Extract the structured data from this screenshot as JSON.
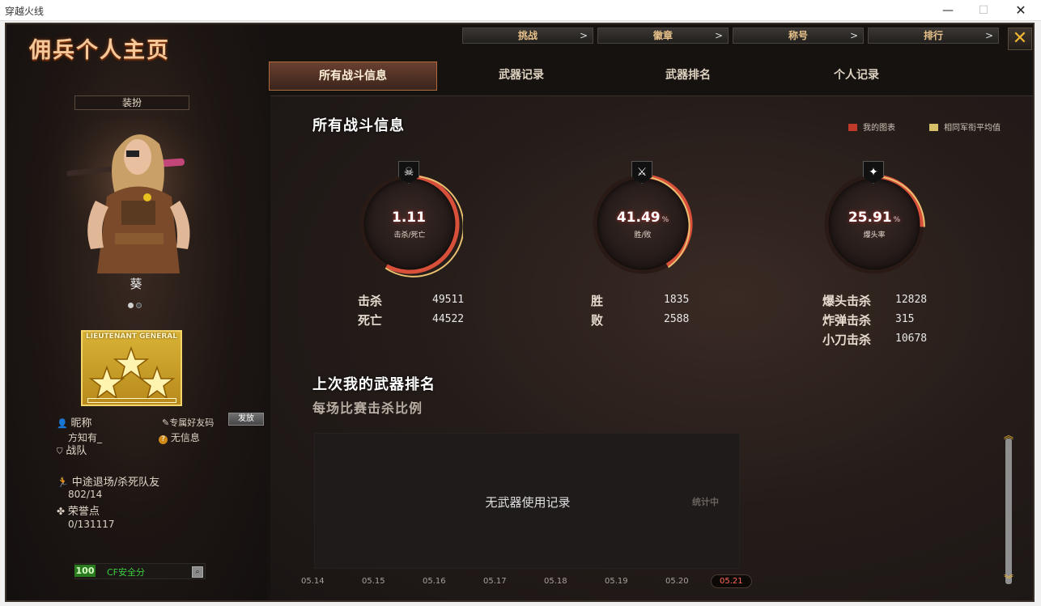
{
  "window": {
    "title": "穿越火线",
    "minimize": "—",
    "maximize": "☐",
    "close": "✕"
  },
  "header": {
    "title": "佣兵个人主页",
    "nav": [
      {
        "label": "挑战",
        "chevron": ">"
      },
      {
        "label": "徽章",
        "chevron": ">"
      },
      {
        "label": "称号",
        "chevron": ">"
      },
      {
        "label": "排行",
        "chevron": ">"
      }
    ],
    "close_label": "✕"
  },
  "left": {
    "outfit_button": "装扮",
    "character_name": "葵",
    "rank_text": "LIEUTENANT GENERAL",
    "nickname_label": "昵称",
    "nickname_value": "方知有_",
    "friend_code_label": "专属好友码",
    "send_button": "发放",
    "no_info": "无信息",
    "team_label": "战队",
    "quit_label": "中途退场/杀死队友",
    "quit_value": "802/14",
    "honor_label": "荣誉点",
    "honor_value": "0/131117",
    "safe_score": "100",
    "safe_label": "CF安全分"
  },
  "tabs": [
    {
      "label": "所有战斗信息",
      "active": true
    },
    {
      "label": "武器记录",
      "active": false
    },
    {
      "label": "武器排名",
      "active": false
    },
    {
      "label": "个人记录",
      "active": false
    }
  ],
  "main": {
    "section_title": "所有战斗信息",
    "legend": [
      {
        "label": "我的图表",
        "color": "#c0392b"
      },
      {
        "label": "相同军衔平均值",
        "color": "#d8c06a"
      }
    ],
    "gauges": [
      {
        "value": "1.11",
        "pct": "",
        "caption": "击杀/死亡",
        "emblem": "☠",
        "fill": 0.58
      },
      {
        "value": "41.49",
        "pct": "%",
        "caption": "胜/败",
        "emblem": "⚔",
        "fill": 0.4149
      },
      {
        "value": "25.91",
        "pct": "%",
        "caption": "爆头率",
        "emblem": "✦",
        "fill": 0.2591
      }
    ],
    "stats": {
      "kill_label": "击杀",
      "kill_value": "49511",
      "death_label": "死亡",
      "death_value": "44522",
      "win_label": "胜",
      "win_value": "1835",
      "loss_label": "败",
      "loss_value": "2588",
      "hs_label": "爆头击杀",
      "hs_value": "12828",
      "bomb_label": "炸弹击杀",
      "bomb_value": "315",
      "knife_label": "小刀击杀",
      "knife_value": "10678"
    },
    "weapon_title": "上次我的武器排名",
    "weapon_subtitle": "每场比赛击杀比例",
    "no_weapon": "无武器使用记录",
    "counting": "统计中",
    "dates": [
      "05.14",
      "05.15",
      "05.16",
      "05.17",
      "05.18",
      "05.19",
      "05.20",
      "05.21"
    ],
    "scroll_up": "︽",
    "scroll_down": "︾"
  }
}
